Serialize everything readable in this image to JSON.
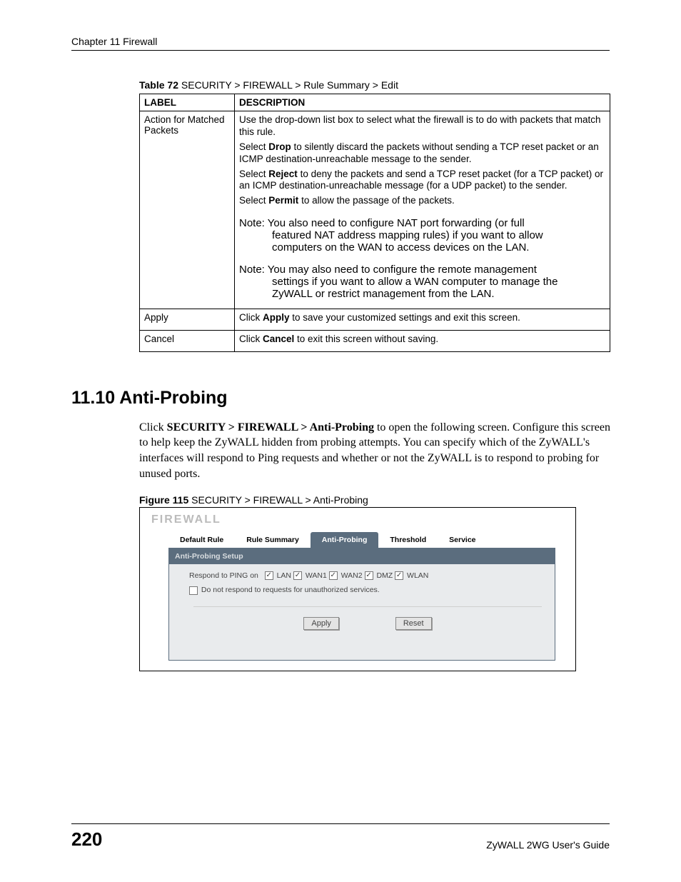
{
  "header": {
    "running": "Chapter 11 Firewall"
  },
  "table72": {
    "caption_bold": "Table 72",
    "caption_rest": "   SECURITY > FIREWALL > Rule Summary > Edit",
    "head_label": "LABEL",
    "head_desc": "DESCRIPTION",
    "rows": [
      {
        "label": "Action for Matched Packets",
        "p1a": "Use the drop-down list box to select what the firewall is to do with packets that match this rule.",
        "p2a": "Select ",
        "p2b": "Drop",
        "p2c": " to silently discard the packets without sending a TCP reset packet or an ICMP destination-unreachable message to the sender.",
        "p3a": "Select ",
        "p3b": "Reject",
        "p3c": " to deny the packets and send a TCP reset packet (for a TCP packet) or an ICMP destination-unreachable message (for a UDP packet) to the sender.",
        "p4a": "Select ",
        "p4b": "Permit",
        "p4c": " to allow the passage of the packets.",
        "note1_lead": "Note: ",
        "note1_first": "You also need to configure NAT port forwarding (or full",
        "note1_rest1": "featured NAT address mapping rules) if you want to allow",
        "note1_rest2": "computers on the WAN to access devices on the LAN.",
        "note2_lead": "Note: ",
        "note2_first": "You may also need to configure the remote management",
        "note2_rest1": "settings if you want to allow a WAN computer to manage the",
        "note2_rest2": "ZyWALL or restrict management from the LAN."
      },
      {
        "label": "Apply",
        "p1": "Click ",
        "p1b": "Apply",
        "p1c": " to save your customized settings and exit this screen."
      },
      {
        "label": "Cancel",
        "p1": "Click ",
        "p1b": "Cancel",
        "p1c": " to exit this screen without saving."
      }
    ]
  },
  "section": {
    "heading": "11.10  Anti-Probing"
  },
  "para": {
    "t1": "Click ",
    "b1": "SECURITY > FIREWALL > Anti-Probing",
    "t2": " to open the following screen. Configure this screen to help keep the ZyWALL hidden from probing attempts. You can specify which of the ZyWALL's interfaces will respond to Ping requests and whether or not the ZyWALL is to respond to probing for unused ports."
  },
  "fig115": {
    "caption_bold": "Figure 115",
    "caption_rest": "   SECURITY > FIREWALL > Anti-Probing",
    "title": "FIREWALL",
    "tabs": [
      "Default Rule",
      "Rule Summary",
      "Anti-Probing",
      "Threshold",
      "Service"
    ],
    "active_tab_index": 2,
    "panel_title": "Anti-Probing Setup",
    "ping_label": "Respond to PING on",
    "ping_opts": [
      {
        "label": "LAN",
        "checked": true
      },
      {
        "label": "WAN1",
        "checked": true
      },
      {
        "label": "WAN2",
        "checked": true
      },
      {
        "label": "DMZ",
        "checked": true
      },
      {
        "label": "WLAN",
        "checked": true
      }
    ],
    "unauth": {
      "label": "Do not respond to requests for unauthorized services.",
      "checked": false
    },
    "buttons": {
      "apply": "Apply",
      "reset": "Reset"
    }
  },
  "footer": {
    "page": "220",
    "guide": "ZyWALL 2WG User's Guide"
  }
}
